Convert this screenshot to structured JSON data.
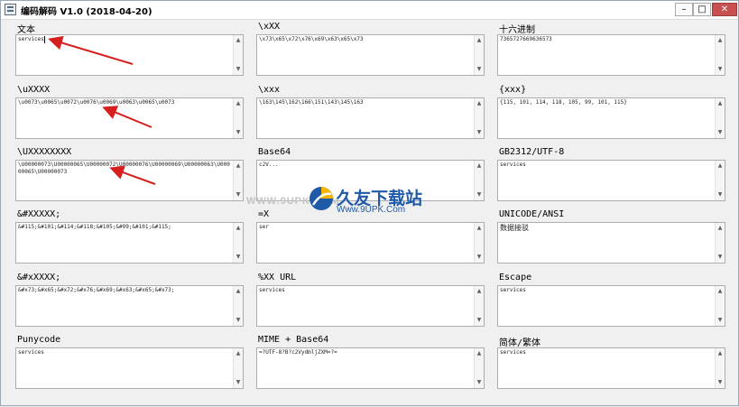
{
  "window": {
    "title": "编码解码 V1.0  (2018-04-20)",
    "controls": {
      "minimize": "–",
      "maximize": "□",
      "close": "✕"
    }
  },
  "panels": [
    {
      "label": "文本",
      "value": "services"
    },
    {
      "label": "\\xXX",
      "value": "\\x73\\x65\\x72\\x76\\x69\\x63\\x65\\x73"
    },
    {
      "label": "十六进制",
      "value": "7365727669636573"
    },
    {
      "label": "\\uXXXX",
      "value": "\\u0073\\u0065\\u0072\\u0076\\u0069\\u0063\\u0065\\u0073"
    },
    {
      "label": "\\xxx",
      "value": "\\163\\145\\162\\166\\151\\143\\145\\163"
    },
    {
      "label": "{xxx}",
      "value": "{115, 101, 114, 118, 105, 99, 101, 115}"
    },
    {
      "label": "\\UXXXXXXXX",
      "value": "\\U00000073\\U00000065\\U00000072\\U00000076\\U00000069\\U00000063\\U00000065\\U00000073"
    },
    {
      "label": "Base64",
      "value": "c2V..."
    },
    {
      "label": "GB2312/UTF-8",
      "value": "services"
    },
    {
      "label": "&#XXXXX;",
      "value": "&#115;&#101;&#114;&#118;&#105;&#99;&#101;&#115;"
    },
    {
      "label": "=X",
      "value": "ser"
    },
    {
      "label": "UNICODE/ANSI",
      "value": "数据接驳"
    },
    {
      "label": "&#xXXXX;",
      "value": "&#x73;&#x65;&#x72;&#x76;&#x69;&#x63;&#x65;&#x73;"
    },
    {
      "label": "%XX   URL",
      "value": "services"
    },
    {
      "label": "Escape",
      "value": "services"
    },
    {
      "label": "Punycode",
      "value": "services"
    },
    {
      "label": "MIME + Base64",
      "value": "=?UTF-8?B?c2VydmljZXM=?="
    },
    {
      "label": "简体/繁体",
      "value": "services"
    }
  ],
  "watermark": {
    "url": "WWW.9UPK.COM",
    "name": "久友下载站",
    "sub": "Www.9UPK.Com"
  },
  "colors": {
    "arrow": "#d62020",
    "accent": "#1e5aa8",
    "logo_yellow": "#f5b400"
  },
  "icons": {
    "scroll_up": "▲",
    "scroll_down": "▼"
  }
}
